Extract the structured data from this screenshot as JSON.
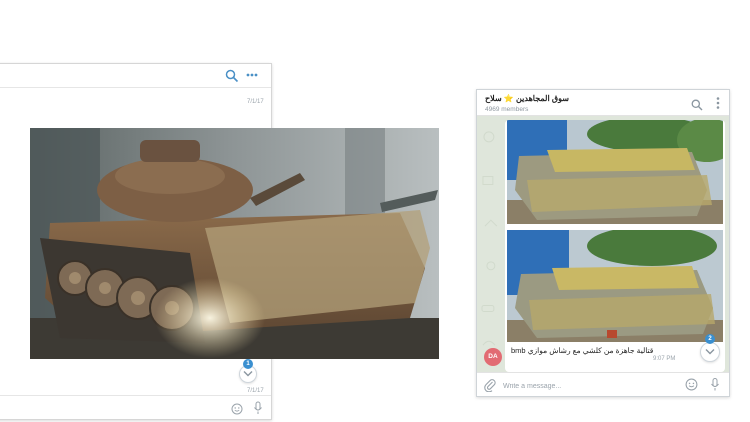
{
  "left_window": {
    "timestamp_top": "7/1/17",
    "timestamp_bottom": "7/1/17",
    "unread_badge": "1"
  },
  "right_window": {
    "channel_title": "سوق المجاهدين ⭐ سلاح",
    "members": "4969 members",
    "message": {
      "caption_arabic": "قتالية جاهزة من كلشي مع رشاش موازي",
      "caption_latin": "bmb",
      "time": "9:07 PM"
    },
    "sender_initials": "DA",
    "unread_badge": "2",
    "input_placeholder": "Write a message..."
  },
  "colors": {
    "accent": "#3a8fd0",
    "avatar": "#e26b73",
    "chat_background": "#dfe6db"
  }
}
